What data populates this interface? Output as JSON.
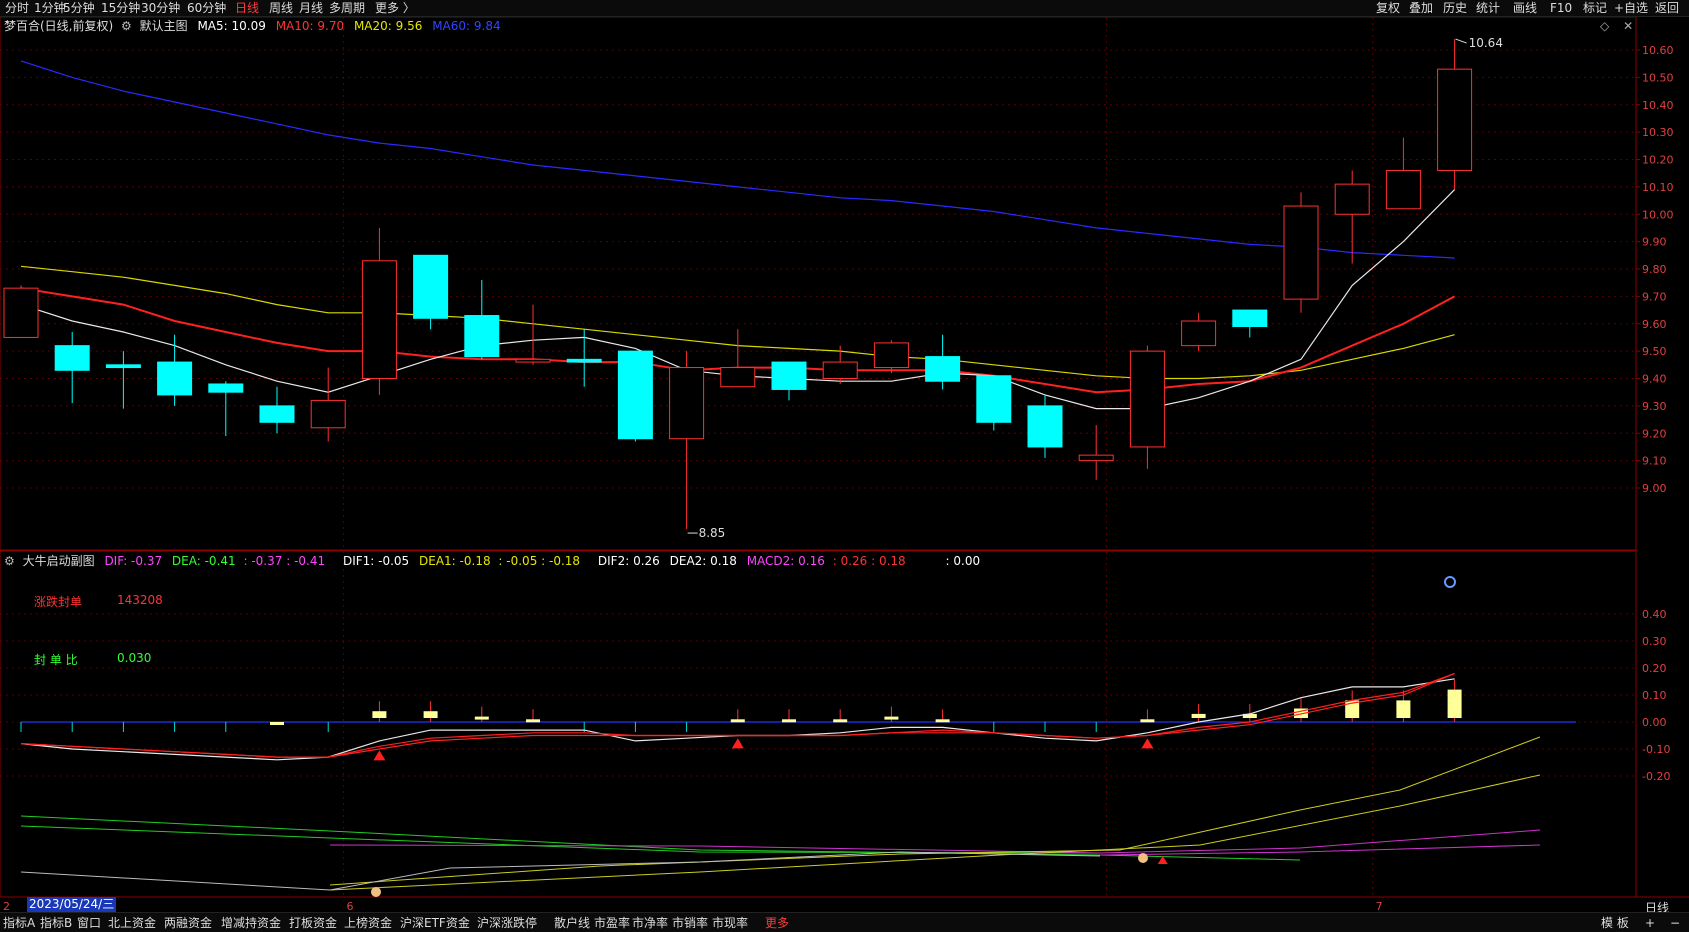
{
  "toolbar": {
    "left_tabs": [
      "分时",
      "1分钟",
      "5分钟",
      "15分钟",
      "30分钟",
      "60分钟",
      "日线",
      "周线",
      "月线",
      "多周期",
      "更多 〉"
    ],
    "active_tab": "日线",
    "right_buttons": [
      "复权",
      "叠加",
      "历史",
      "统计",
      "画线",
      "F10",
      "标记",
      "+自选",
      "返回"
    ]
  },
  "main_info": {
    "stock_title": "梦百合(日线,前复权)",
    "gear_icon": "settings-gear",
    "view_name": "默认主图",
    "ma5": "MA5: 10.09",
    "ma10": "MA10: 9.70",
    "ma20": "MA20: 9.56",
    "ma60": "MA60: 9.84",
    "colors": {
      "ma5": "#ffffff",
      "ma10": "#ff3333",
      "ma20": "#e6e600",
      "ma60": "#3333ff"
    }
  },
  "price_axis_ticks": [
    "10.60",
    "10.50",
    "10.40",
    "10.30",
    "10.20",
    "10.10",
    "10.00",
    "9.90",
    "9.80",
    "9.70",
    "9.60",
    "9.50",
    "9.40",
    "9.30",
    "9.20",
    "9.10",
    "9.00"
  ],
  "annotations": {
    "high": "10.64",
    "low": "8.85"
  },
  "sub_info": {
    "title": "大牛启动副图",
    "dif": "DIF: -0.37",
    "dea": "DEA: -0.41",
    "pair1": ": -0.37 : -0.41",
    "dif1": "DIF1: -0.05",
    "dea1": "DEA1: -0.18",
    "pair2": ": -0.05 : -0.18",
    "dif2": "DIF2: 0.26",
    "dea2": "DEA2: 0.18",
    "macd2": "MACD2: 0.16",
    "pair3": ": 0.26 : 0.18",
    "extra": ": 0.00"
  },
  "sub_side": {
    "limit_label": "涨跌封单",
    "limit_value": "143208",
    "ratio_label": "封 单 比",
    "ratio_value": "0.030"
  },
  "sub_axis_ticks": [
    "0.40",
    "0.30",
    "0.20",
    "0.10",
    "0.00",
    "-0.10",
    "-0.20"
  ],
  "date_marks": {
    "left": "2",
    "cursor_date": "2023/05/24/三",
    "m6": "6",
    "m7": "7"
  },
  "period_label": "日线",
  "bottom_tabs": [
    "指标A",
    "指标B",
    "窗口",
    "北上资金",
    "两融资金",
    "增减持资金",
    "打板资金",
    "上榜资金",
    "沪深ETF资金",
    "沪深涨跌停",
    "散户线",
    "市盈率",
    "市净率",
    "市销率",
    "市现率",
    "更多"
  ],
  "bottom_active": "更多",
  "bottom_right": [
    "模 板",
    "+",
    "−"
  ],
  "chart_data": {
    "type": "candlestick",
    "candles": [
      {
        "o": 9.55,
        "h": 9.74,
        "l": 9.55,
        "c": 9.73
      },
      {
        "o": 9.52,
        "h": 9.57,
        "l": 9.31,
        "c": 9.43
      },
      {
        "o": 9.45,
        "h": 9.5,
        "l": 9.29,
        "c": 9.44
      },
      {
        "o": 9.46,
        "h": 9.56,
        "l": 9.3,
        "c": 9.34
      },
      {
        "o": 9.38,
        "h": 9.39,
        "l": 9.19,
        "c": 9.35
      },
      {
        "o": 9.3,
        "h": 9.37,
        "l": 9.2,
        "c": 9.24
      },
      {
        "o": 9.22,
        "h": 9.44,
        "l": 9.17,
        "c": 9.32
      },
      {
        "o": 9.4,
        "h": 9.95,
        "l": 9.34,
        "c": 9.83
      },
      {
        "o": 9.85,
        "h": 9.85,
        "l": 9.58,
        "c": 9.62
      },
      {
        "o": 9.63,
        "h": 9.76,
        "l": 9.47,
        "c": 9.48
      },
      {
        "o": 9.46,
        "h": 9.67,
        "l": 9.45,
        "c": 9.47
      },
      {
        "o": 9.47,
        "h": 9.58,
        "l": 9.37,
        "c": 9.46
      },
      {
        "o": 9.5,
        "h": 9.5,
        "l": 9.17,
        "c": 9.18
      },
      {
        "o": 9.18,
        "h": 9.5,
        "l": 8.85,
        "c": 9.44
      },
      {
        "o": 9.37,
        "h": 9.58,
        "l": 9.37,
        "c": 9.44
      },
      {
        "o": 9.46,
        "h": 9.46,
        "l": 9.32,
        "c": 9.36
      },
      {
        "o": 9.4,
        "h": 9.52,
        "l": 9.38,
        "c": 9.46
      },
      {
        "o": 9.44,
        "h": 9.54,
        "l": 9.42,
        "c": 9.53
      },
      {
        "o": 9.48,
        "h": 9.56,
        "l": 9.36,
        "c": 9.39
      },
      {
        "o": 9.41,
        "h": 9.41,
        "l": 9.21,
        "c": 9.24
      },
      {
        "o": 9.3,
        "h": 9.34,
        "l": 9.11,
        "c": 9.15
      },
      {
        "o": 9.1,
        "h": 9.23,
        "l": 9.03,
        "c": 9.12
      },
      {
        "o": 9.15,
        "h": 9.52,
        "l": 9.07,
        "c": 9.5
      },
      {
        "o": 9.52,
        "h": 9.64,
        "l": 9.5,
        "c": 9.61
      },
      {
        "o": 9.65,
        "h": 9.65,
        "l": 9.55,
        "c": 9.59
      },
      {
        "o": 9.69,
        "h": 10.08,
        "l": 9.64,
        "c": 10.03
      },
      {
        "o": 10.0,
        "h": 10.16,
        "l": 9.82,
        "c": 10.11
      },
      {
        "o": 10.02,
        "h": 10.28,
        "l": 10.02,
        "c": 10.16
      },
      {
        "o": 10.16,
        "h": 10.64,
        "l": 10.09,
        "c": 10.53
      }
    ],
    "ma5": [
      9.67,
      9.61,
      9.57,
      9.52,
      9.45,
      9.39,
      9.35,
      9.41,
      9.47,
      9.52,
      9.54,
      9.55,
      9.51,
      9.43,
      9.41,
      9.4,
      9.39,
      9.39,
      9.42,
      9.41,
      9.34,
      9.29,
      9.29,
      9.33,
      9.39,
      9.47,
      9.74,
      9.9,
      10.09
    ],
    "ma10": [
      9.73,
      9.7,
      9.67,
      9.61,
      9.57,
      9.53,
      9.5,
      9.5,
      9.48,
      9.47,
      9.47,
      9.46,
      9.46,
      9.43,
      9.44,
      9.44,
      9.43,
      9.43,
      9.43,
      9.41,
      9.38,
      9.35,
      9.36,
      9.38,
      9.39,
      9.44,
      9.52,
      9.6,
      9.7
    ],
    "ma20": [
      9.81,
      9.79,
      9.77,
      9.74,
      9.71,
      9.67,
      9.64,
      9.64,
      9.63,
      9.62,
      9.6,
      9.58,
      9.56,
      9.54,
      9.52,
      9.51,
      9.5,
      9.48,
      9.47,
      9.45,
      9.43,
      9.41,
      9.4,
      9.4,
      9.41,
      9.43,
      9.47,
      9.51,
      9.56
    ],
    "ma60": [
      10.56,
      10.5,
      10.45,
      10.41,
      10.37,
      10.33,
      10.29,
      10.26,
      10.24,
      10.21,
      10.18,
      10.16,
      10.14,
      10.12,
      10.1,
      10.08,
      10.06,
      10.05,
      10.03,
      10.01,
      9.98,
      9.95,
      9.93,
      9.91,
      9.89,
      9.88,
      9.86,
      9.85,
      9.84
    ],
    "price_range": [
      8.85,
      10.64
    ],
    "sub_series": {
      "white": [
        -0.08,
        -0.1,
        -0.11,
        -0.12,
        -0.13,
        -0.14,
        -0.13,
        -0.07,
        -0.03,
        -0.03,
        -0.03,
        -0.03,
        -0.07,
        -0.06,
        -0.05,
        -0.05,
        -0.04,
        -0.02,
        -0.02,
        -0.04,
        -0.06,
        -0.07,
        -0.04,
        0.0,
        0.03,
        0.09,
        0.13,
        0.13,
        0.16
      ],
      "red": [
        -0.08,
        -0.09,
        -0.1,
        -0.11,
        -0.12,
        -0.13,
        -0.13,
        -0.09,
        -0.06,
        -0.05,
        -0.04,
        -0.04,
        -0.05,
        -0.05,
        -0.05,
        -0.05,
        -0.05,
        -0.04,
        -0.03,
        -0.04,
        -0.05,
        -0.06,
        -0.05,
        -0.02,
        0.0,
        0.04,
        0.08,
        0.11,
        0.18
      ],
      "red2": [
        -0.08,
        -0.09,
        -0.1,
        -0.11,
        -0.12,
        -0.13,
        -0.13,
        -0.1,
        -0.07,
        -0.06,
        -0.05,
        -0.05,
        -0.05,
        -0.05,
        -0.05,
        -0.05,
        -0.05,
        -0.04,
        -0.04,
        -0.04,
        -0.05,
        -0.06,
        -0.05,
        -0.03,
        -0.01,
        0.03,
        0.07,
        0.1,
        0.18
      ],
      "bars": [
        0,
        0,
        0,
        0,
        0,
        -0.01,
        0,
        0.04,
        0.04,
        0.02,
        0.01,
        0,
        0,
        0,
        0.01,
        0.01,
        0.01,
        0.02,
        0.01,
        0,
        0,
        0,
        0.01,
        0.03,
        0.03,
        0.05,
        0.08,
        0.08,
        0.12
      ]
    }
  }
}
